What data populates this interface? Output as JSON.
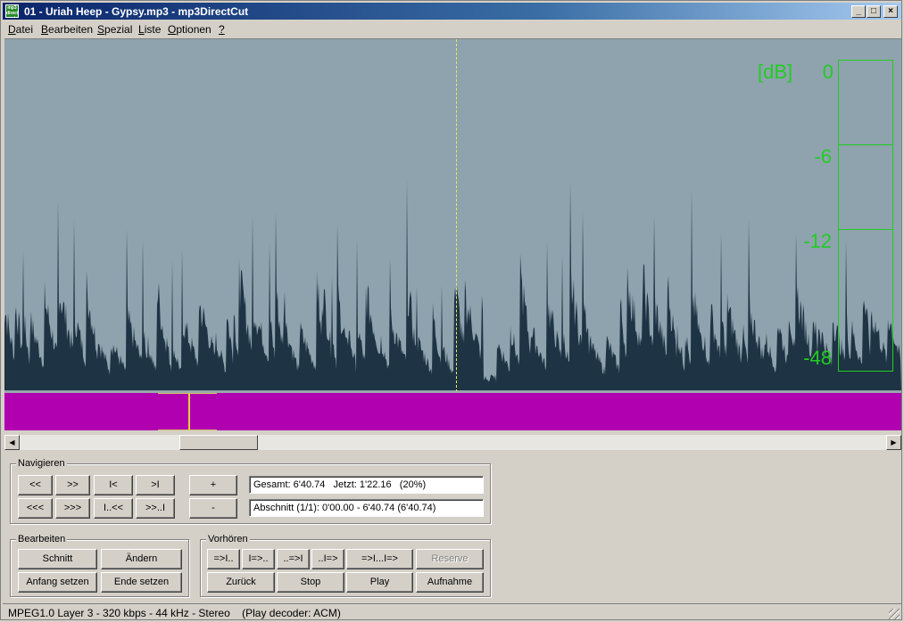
{
  "window": {
    "title": "01 - Uriah Heep - Gypsy.mp3 - mp3DirectCut",
    "app_icon_text": "mp3 direct cut",
    "controls": [
      "minimize-icon",
      "maximize-icon",
      "close-icon"
    ]
  },
  "menu": [
    {
      "label": "Datei",
      "accel": "D"
    },
    {
      "label": "Bearbeiten",
      "accel": "B"
    },
    {
      "label": "Spezial",
      "accel": "S"
    },
    {
      "label": "Liste",
      "accel": "L"
    },
    {
      "label": "Optionen",
      "accel": "O"
    },
    {
      "label": "?",
      "accel": "?"
    }
  ],
  "waveform": {
    "background": "#8ea3ad",
    "wave_color": "#1e3344",
    "cursor_color": "#e8e860",
    "meter_color": "#22cc22",
    "db_unit": "[dB]",
    "db_marks": [
      "0",
      "-6",
      "-12",
      "-48"
    ]
  },
  "overview": {
    "color": "#b000b0",
    "position_marker_color": "#e8d040"
  },
  "navigieren": {
    "legend": "Navigieren",
    "row1": [
      "<<",
      ">>",
      "I<",
      ">I"
    ],
    "row2": [
      "<<<",
      ">>>",
      "I..<<",
      ">>..I"
    ],
    "plus": "+",
    "minus": "-",
    "info1": "Gesamt: 6'40.74   Jetzt: 1'22.16   (20%)",
    "info2": "Abschnitt (1/1): 0'00.00 - 6'40.74 (6'40.74)"
  },
  "bearbeiten": {
    "legend": "Bearbeiten",
    "schnitt": "Schnitt",
    "aendern": "Ändern",
    "anfang": "Anfang setzen",
    "ende": "Ende setzen"
  },
  "vorhoeren": {
    "legend": "Vorhören",
    "row1": [
      "=>I..",
      "I=>..",
      "..=>I",
      "..I=>",
      "=>I...I=>",
      "Reserve"
    ],
    "row2": [
      "Zurück",
      "Stop",
      "Play",
      "Aufnahme"
    ]
  },
  "status": {
    "text": "MPEG1.0 Layer 3 - 320 kbps - 44 kHz - Stereo    (Play decoder: ACM)"
  }
}
